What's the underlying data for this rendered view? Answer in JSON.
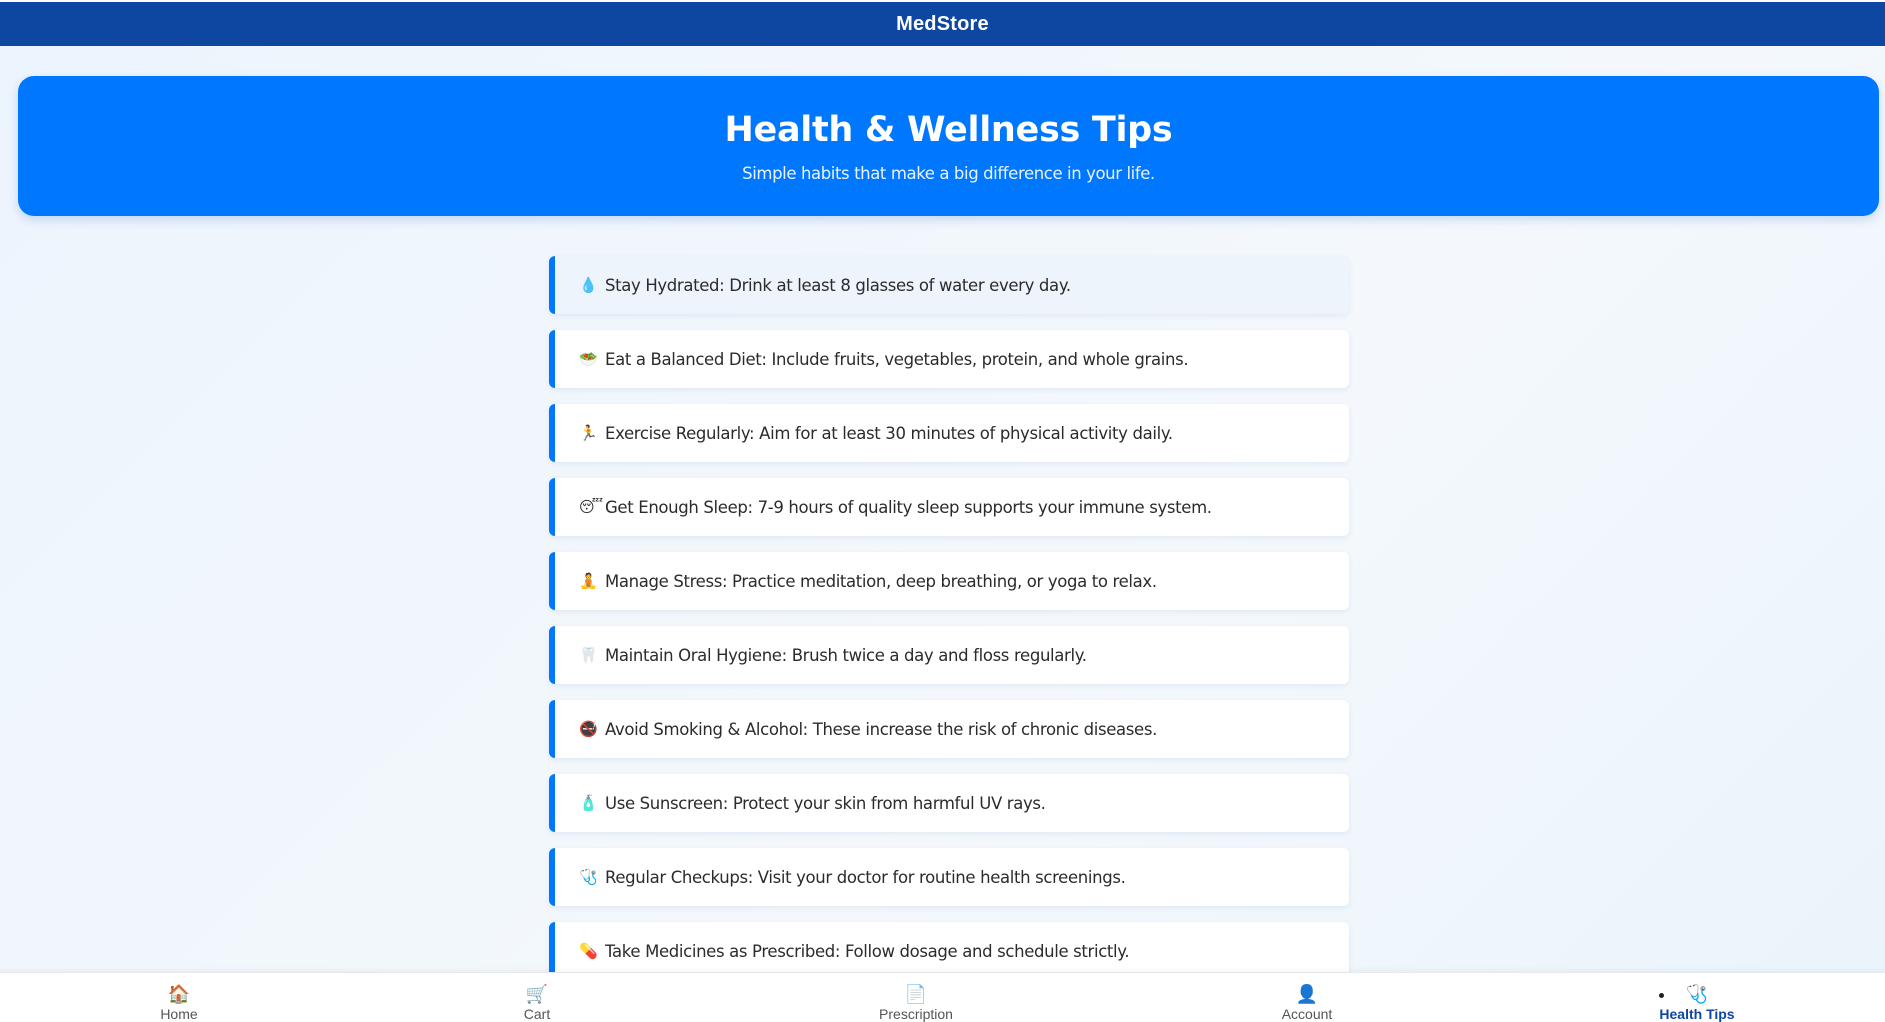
{
  "app": {
    "title": "MedStore"
  },
  "hero": {
    "title": "Health & Wellness Tips",
    "subtitle": "Simple habits that make a big difference in your life."
  },
  "tips": [
    {
      "icon": "💧",
      "icon_name": "water-drop-icon",
      "text": "Stay Hydrated: Drink at least 8 glasses of water every day."
    },
    {
      "icon": "🥗",
      "icon_name": "salad-icon",
      "text": "Eat a Balanced Diet: Include fruits, vegetables, protein, and whole grains."
    },
    {
      "icon": "🏃",
      "icon_name": "running-icon",
      "text": "Exercise Regularly: Aim for at least 30 minutes of physical activity daily."
    },
    {
      "icon": "😴",
      "icon_name": "sleeping-face-icon",
      "text": "Get Enough Sleep: 7-9 hours of quality sleep supports your immune system."
    },
    {
      "icon": "🧘",
      "icon_name": "meditation-icon",
      "text": "Manage Stress: Practice meditation, deep breathing, or yoga to relax."
    },
    {
      "icon": "🦷",
      "icon_name": "tooth-icon",
      "text": "Maintain Oral Hygiene: Brush twice a day and floss regularly."
    },
    {
      "icon": "🚭",
      "icon_name": "no-smoking-icon",
      "text": "Avoid Smoking & Alcohol: These increase the risk of chronic diseases."
    },
    {
      "icon": "🧴",
      "icon_name": "lotion-bottle-icon",
      "text": "Use Sunscreen: Protect your skin from harmful UV rays."
    },
    {
      "icon": "🩺",
      "icon_name": "stethoscope-icon",
      "text": "Regular Checkups: Visit your doctor for routine health screenings."
    },
    {
      "icon": "💊",
      "icon_name": "pill-icon",
      "text": "Take Medicines as Prescribed: Follow dosage and schedule strictly."
    }
  ],
  "nav": {
    "active": "health-tips",
    "items": [
      {
        "key": "home",
        "icon": "🏠",
        "icon_name": "home-icon",
        "label": "Home"
      },
      {
        "key": "cart",
        "icon": "🛒",
        "icon_name": "cart-icon",
        "label": "Cart"
      },
      {
        "key": "prescription",
        "icon": "📄",
        "icon_name": "document-icon",
        "label": "Prescription"
      },
      {
        "key": "account",
        "icon": "👤",
        "icon_name": "user-icon",
        "label": "Account"
      },
      {
        "key": "health-tips",
        "icon": "🩺",
        "icon_name": "stethoscope-icon",
        "label": "Health Tips"
      }
    ]
  },
  "colors": {
    "topbar": "#0d47a1",
    "hero": "#0077ff",
    "tip_accent": "#0077ff",
    "nav_active": "#0d47a1"
  }
}
